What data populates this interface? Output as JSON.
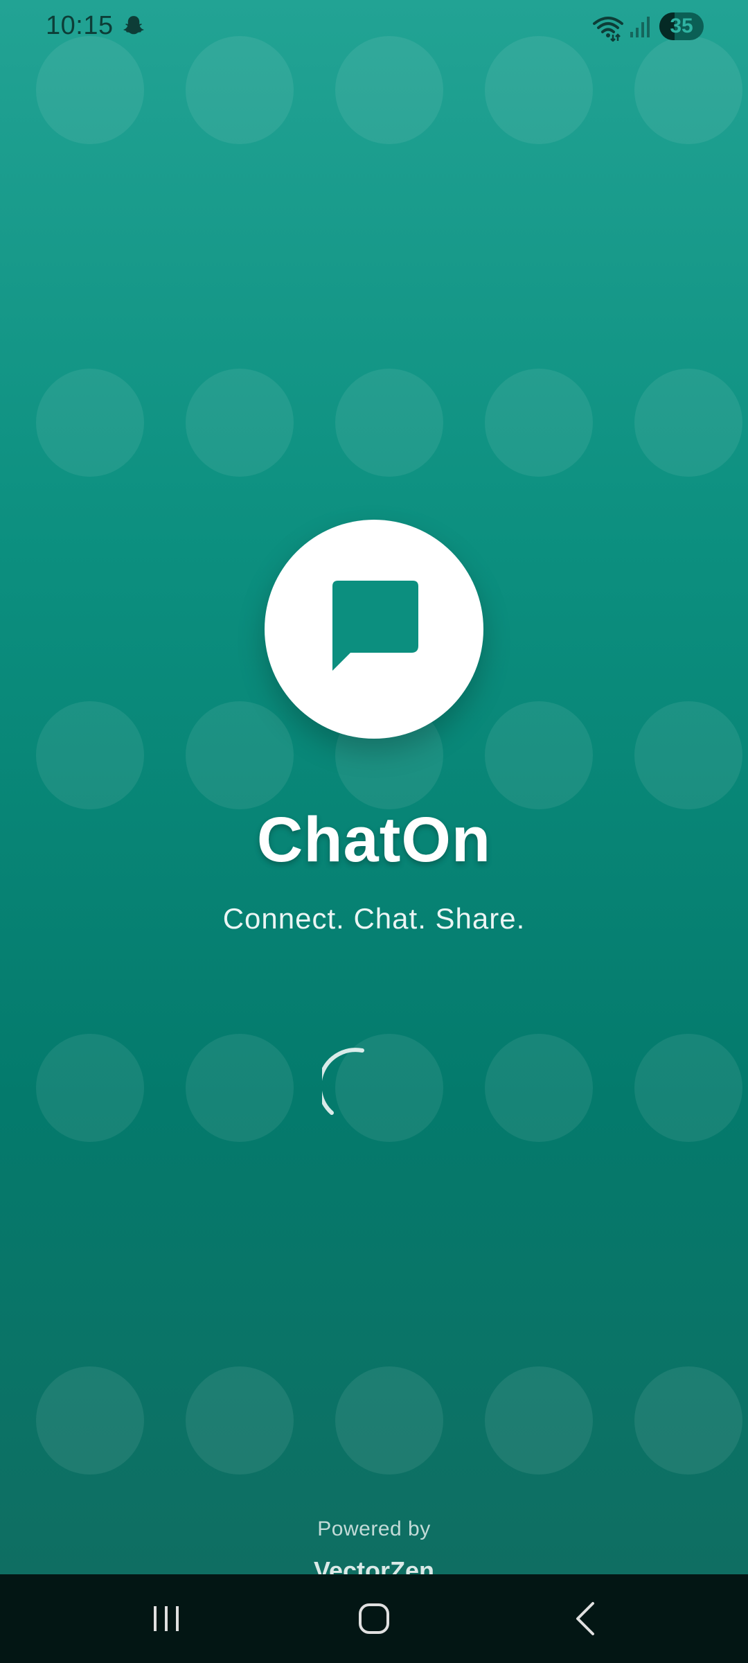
{
  "status_bar": {
    "time": "10:15",
    "battery_level": "35",
    "icons": [
      "snapchat-ghost-icon",
      "wifi-icon",
      "signal-icon",
      "battery-icon"
    ]
  },
  "splash": {
    "app_name": "ChatOn",
    "tagline": "Connect. Chat. Share.",
    "powered_by_label": "Powered by",
    "brand_name": "VectorZen",
    "logo_icon": "chat-bubble-icon",
    "loading_indicator": "spinner"
  },
  "nav_bar": {
    "buttons": [
      "recent-apps",
      "home",
      "back"
    ]
  },
  "colors": {
    "primary": "#0c8f7f",
    "primary_light": "#22a394",
    "primary_dark": "#0f6e62",
    "logo_background": "#ffffff",
    "nav_background": "#031614"
  }
}
